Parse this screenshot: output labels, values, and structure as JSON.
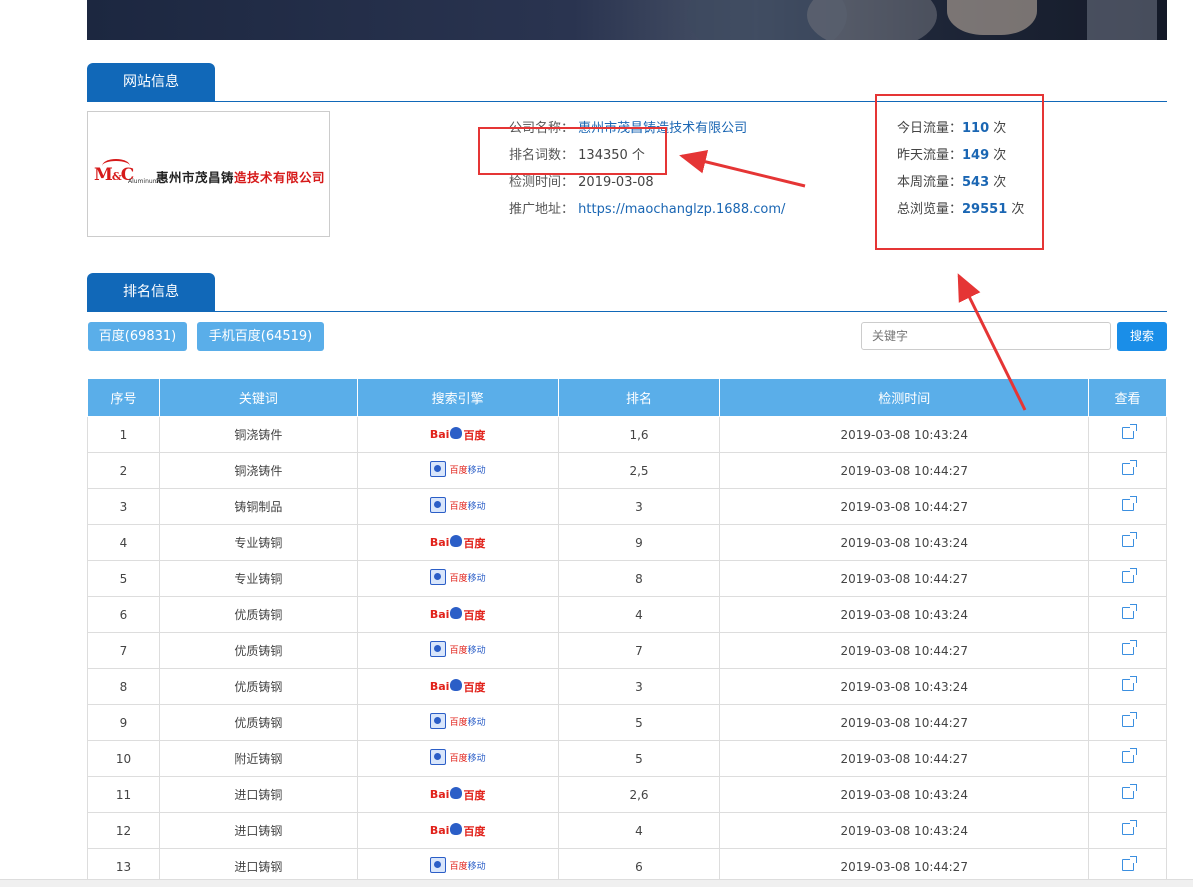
{
  "site_info": {
    "tab_label": "网站信息",
    "logo": {
      "mc": "M",
      "amp": "&",
      "c": "C",
      "aluminum": "Aluminum",
      "name_black": "惠州市茂昌铸",
      "name_red": "造技术有限公司"
    },
    "company_label": "公司名称：",
    "company_value": "惠州市茂昌铸造技术有限公司",
    "keywords_label": "排名词数：",
    "keywords_value": "134350 个",
    "check_time_label": "检测时间：",
    "check_time_value": "2019-03-08",
    "promo_label": "推广地址：",
    "promo_value": "https://maochanglzp.1688.com/"
  },
  "traffic": {
    "today_label": "今日流量：",
    "today_value": "110",
    "today_unit": "次",
    "yesterday_label": "昨天流量：",
    "yesterday_value": "149",
    "yesterday_unit": "次",
    "week_label": "本周流量：",
    "week_value": "543",
    "week_unit": "次",
    "total_label": "总浏览量：",
    "total_value": "29551",
    "total_unit": "次"
  },
  "ranking": {
    "tab_label": "排名信息",
    "filter_baidu": "百度(69831)",
    "filter_mobile": "手机百度(64519)",
    "search_placeholder": "关键字",
    "search_button": "搜索",
    "columns": [
      "序号",
      "关键词",
      "搜索引擎",
      "排名",
      "检测时间",
      "查看"
    ],
    "engines": {
      "baidu_bai": "Bai",
      "baidu_du": "百度",
      "mobile_t1": "百度",
      "mobile_t2": "移动"
    }
  },
  "rows": [
    {
      "no": "1",
      "kw": "铜浇铸件",
      "engine": "baidu",
      "rank": "1,6",
      "time": "2019-03-08 10:43:24"
    },
    {
      "no": "2",
      "kw": "铜浇铸件",
      "engine": "mobile",
      "rank": "2,5",
      "time": "2019-03-08 10:44:27"
    },
    {
      "no": "3",
      "kw": "铸铜制品",
      "engine": "mobile",
      "rank": "3",
      "time": "2019-03-08 10:44:27"
    },
    {
      "no": "4",
      "kw": "专业铸铜",
      "engine": "baidu",
      "rank": "9",
      "time": "2019-03-08 10:43:24"
    },
    {
      "no": "5",
      "kw": "专业铸铜",
      "engine": "mobile",
      "rank": "8",
      "time": "2019-03-08 10:44:27"
    },
    {
      "no": "6",
      "kw": "优质铸铜",
      "engine": "baidu",
      "rank": "4",
      "time": "2019-03-08 10:43:24"
    },
    {
      "no": "7",
      "kw": "优质铸铜",
      "engine": "mobile",
      "rank": "7",
      "time": "2019-03-08 10:44:27"
    },
    {
      "no": "8",
      "kw": "优质铸钢",
      "engine": "baidu",
      "rank": "3",
      "time": "2019-03-08 10:43:24"
    },
    {
      "no": "9",
      "kw": "优质铸钢",
      "engine": "mobile",
      "rank": "5",
      "time": "2019-03-08 10:44:27"
    },
    {
      "no": "10",
      "kw": "附近铸钢",
      "engine": "mobile",
      "rank": "5",
      "time": "2019-03-08 10:44:27"
    },
    {
      "no": "11",
      "kw": "进口铸铜",
      "engine": "baidu",
      "rank": "2,6",
      "time": "2019-03-08 10:43:24"
    },
    {
      "no": "12",
      "kw": "进口铸钢",
      "engine": "baidu",
      "rank": "4",
      "time": "2019-03-08 10:43:24"
    },
    {
      "no": "13",
      "kw": "进口铸钢",
      "engine": "mobile",
      "rank": "6",
      "time": "2019-03-08 10:44:27"
    }
  ],
  "colors": {
    "primary": "#1168b8",
    "header_blue": "#5aaee9",
    "link_blue": "#1a66b3",
    "annotation_red": "#e53535"
  }
}
